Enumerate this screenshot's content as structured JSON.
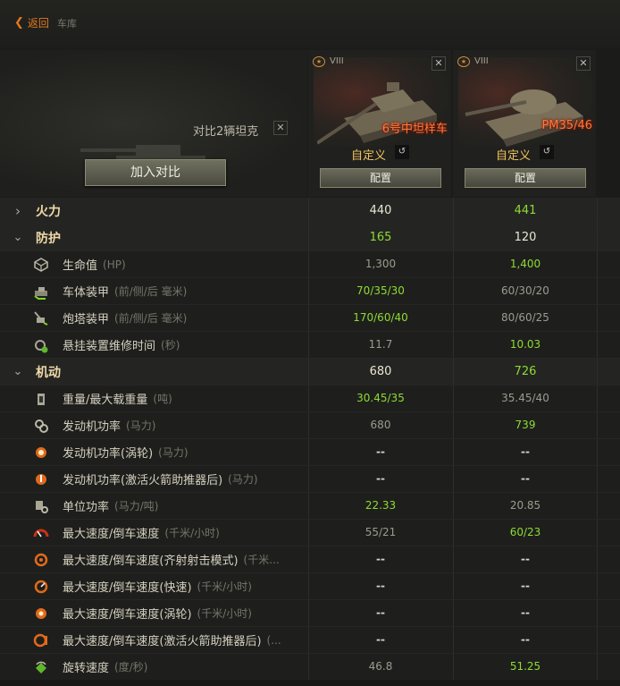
{
  "nav": {
    "back": "返回",
    "breadcrumb": "车库"
  },
  "header": {
    "compare_count": "对比2辆坦克",
    "add_button": "加入对比"
  },
  "tanks": [
    {
      "tier": "VIII",
      "name": "6号中坦样车",
      "custom": "自定义",
      "config": "配置"
    },
    {
      "tier": "VIII",
      "name": "PM35/46",
      "custom": "自定义",
      "config": "配置"
    }
  ],
  "rows": [
    {
      "section": true,
      "expanded": false,
      "name": "火力",
      "v1": "440",
      "v2": "441",
      "c1": "white",
      "c2": "green"
    },
    {
      "section": true,
      "expanded": true,
      "name": "防护",
      "v1": "165",
      "v2": "120",
      "c1": "green",
      "c2": "white"
    },
    {
      "icon": "hp-icon",
      "name": "生命值",
      "unit": "(HP)",
      "v1": "1,300",
      "v2": "1,400",
      "c1": "grey",
      "c2": "green"
    },
    {
      "icon": "hull-armor-icon",
      "name": "车体装甲",
      "unit": "(前/侧/后 毫米)",
      "v1": "70/35/30",
      "v2": "60/30/20",
      "c1": "green",
      "c2": "grey"
    },
    {
      "icon": "turret-armor-icon",
      "name": "炮塔装甲",
      "unit": "(前/侧/后 毫米)",
      "v1": "170/60/40",
      "v2": "80/60/25",
      "c1": "green",
      "c2": "grey"
    },
    {
      "icon": "repair-icon",
      "name": "悬挂装置维修时间",
      "unit": "(秒)",
      "v1": "11.7",
      "v2": "10.03",
      "c1": "grey",
      "c2": "green"
    },
    {
      "section": true,
      "expanded": true,
      "name": "机动",
      "v1": "680",
      "v2": "726",
      "c1": "white",
      "c2": "green"
    },
    {
      "icon": "weight-icon",
      "name": "重量/最大载重量",
      "unit": "(吨)",
      "v1": "30.45/35",
      "v2": "35.45/40",
      "c1": "green",
      "c2": "grey"
    },
    {
      "icon": "engine-power-icon",
      "name": "发动机功率",
      "unit": "(马力)",
      "v1": "680",
      "v2": "739",
      "c1": "grey",
      "c2": "green"
    },
    {
      "icon": "turbo-engine-icon",
      "name": "发动机功率(涡轮)",
      "unit": "(马力)",
      "v1": "--",
      "v2": "--",
      "c1": "dash",
      "c2": "dash"
    },
    {
      "icon": "rocket-engine-icon",
      "name": "发动机功率(激活火箭助推器后)",
      "unit": "(马力)",
      "v1": "--",
      "v2": "--",
      "c1": "dash",
      "c2": "dash"
    },
    {
      "icon": "specific-power-icon",
      "name": "单位功率",
      "unit": "(马力/吨)",
      "v1": "22.33",
      "v2": "20.85",
      "c1": "green",
      "c2": "grey"
    },
    {
      "icon": "speed-icon",
      "name": "最大速度/倒车速度",
      "unit": "(千米/小时)",
      "v1": "55/21",
      "v2": "60/23",
      "c1": "grey",
      "c2": "green"
    },
    {
      "icon": "siege-speed-icon",
      "name": "最大速度/倒车速度(齐射射击模式)",
      "unit": "(千米...",
      "v1": "--",
      "v2": "--",
      "c1": "dash",
      "c2": "dash"
    },
    {
      "icon": "fast-speed-icon",
      "name": "最大速度/倒车速度(快速)",
      "unit": "(千米/小时)",
      "v1": "--",
      "v2": "--",
      "c1": "dash",
      "c2": "dash"
    },
    {
      "icon": "turbo-speed-icon",
      "name": "最大速度/倒车速度(涡轮)",
      "unit": "(千米/小时)",
      "v1": "--",
      "v2": "--",
      "c1": "dash",
      "c2": "dash"
    },
    {
      "icon": "rocket-speed-icon",
      "name": "最大速度/倒车速度(激活火箭助推器后)",
      "unit": "(...",
      "v1": "--",
      "v2": "--",
      "c1": "dash",
      "c2": "dash"
    },
    {
      "icon": "traverse-icon",
      "name": "旋转速度",
      "unit": "(度/秒)",
      "v1": "46.8",
      "v2": "51.25",
      "c1": "grey",
      "c2": "green"
    }
  ],
  "colors": {
    "accent": "#e07a1e",
    "better": "#8edb34",
    "tank_name": "#ff7a3a",
    "custom": "#f1c05c"
  }
}
